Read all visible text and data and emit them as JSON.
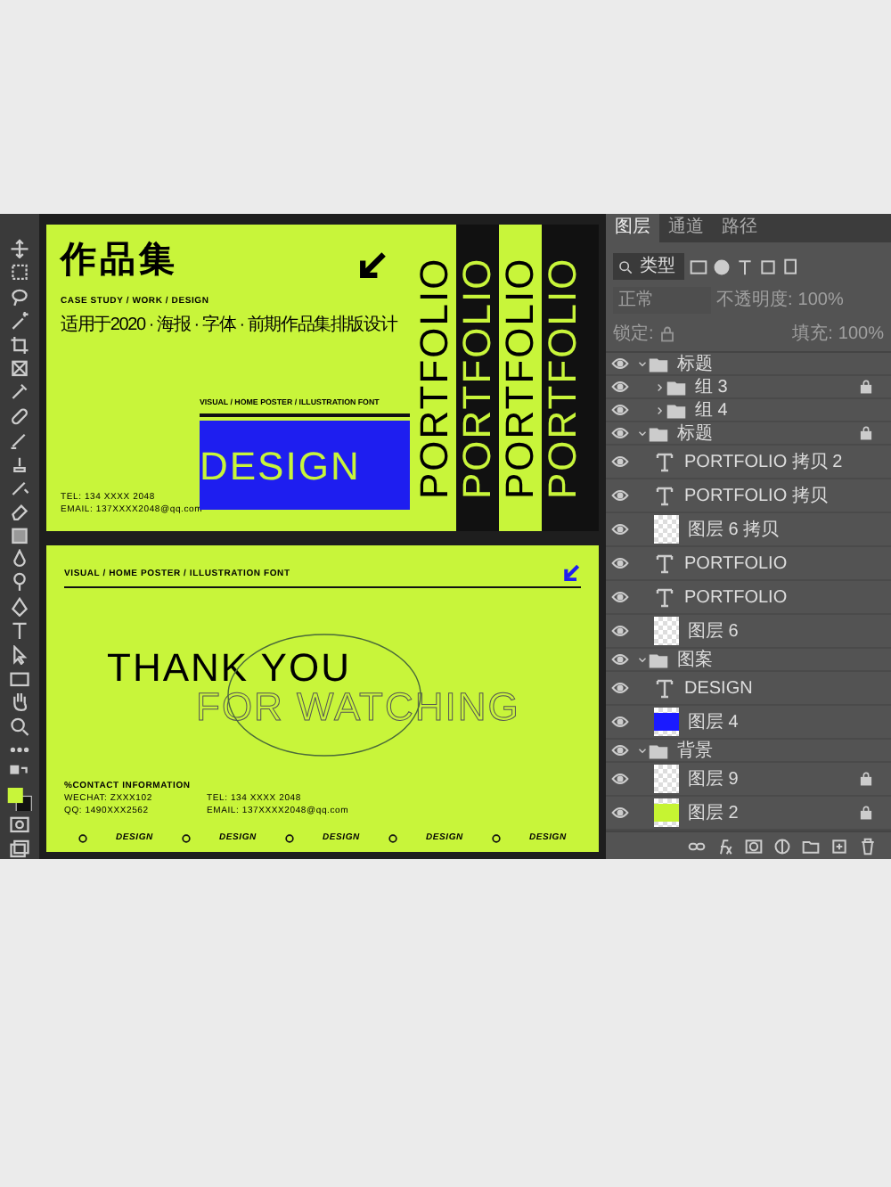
{
  "artboard_top": {
    "title": "作品集",
    "subtitle": "CASE STUDY / WORK / DESIGN",
    "description": "适用于2020 · 海报 · 字体 · 前期作品集排版设计",
    "tagline": "VISUAL / HOME POSTER / ILLUSTRATION FONT",
    "design": "DESIGN",
    "contacts": [
      "TEL: 134 XXXX 2048",
      "EMAIL: 137XXXX2048@qq.com"
    ],
    "portfolio": [
      {
        "text": "PORTFOLIO",
        "inverted": false
      },
      {
        "text": "PORTFOLIO",
        "inverted": true
      },
      {
        "text": "PORTFOLIO",
        "inverted": false
      },
      {
        "text": "PORTFOLIO",
        "inverted": true
      }
    ]
  },
  "artboard_bottom": {
    "tagline": "VISUAL / HOME POSTER / ILLUSTRATION FONT",
    "headline": "THANK YOU",
    "subheadline": "FOR WATCHING",
    "contact_heading": "%CONTACT INFORMATION",
    "contacts": [
      "WECHAT: ZXXX102",
      "TEL: 134 XXXX 2048",
      "QQ: 1490XXX2562",
      "EMAIL: 137XXXX2048@qq.com"
    ],
    "marquee": [
      "DESIGN",
      "DESIGN",
      "DESIGN",
      "DESIGN",
      "DESIGN"
    ]
  },
  "layers_panel": {
    "tabs": [
      {
        "label": "图层",
        "selected": true
      },
      {
        "label": "通道",
        "selected": false
      },
      {
        "label": "路径",
        "selected": false
      }
    ],
    "filter": "类型",
    "blend_mode": "正常",
    "opacity_label": "不透明度:",
    "opacity": "100%",
    "lock_label": "锁定:",
    "fill_label": "填充:",
    "fill": "100%",
    "layers": [
      {
        "name": "标题",
        "kind": "group",
        "expanded": true,
        "locked": false,
        "children": [
          {
            "name": "组 3",
            "kind": "group",
            "expanded": false,
            "locked": true
          },
          {
            "name": "组 4",
            "kind": "group",
            "expanded": false,
            "locked": false
          }
        ]
      },
      {
        "name": "标题",
        "kind": "group",
        "expanded": true,
        "locked": true,
        "children": [
          {
            "name": "PORTFOLIO 拷贝 2",
            "kind": "text",
            "locked": false
          },
          {
            "name": "PORTFOLIO 拷贝",
            "kind": "text",
            "locked": false
          },
          {
            "name": "图层 6 拷贝",
            "kind": "pixel",
            "locked": false
          },
          {
            "name": "PORTFOLIO",
            "kind": "text",
            "locked": false
          },
          {
            "name": "PORTFOLIO",
            "kind": "text",
            "locked": false
          },
          {
            "name": "图层 6",
            "kind": "pixel",
            "locked": false
          }
        ]
      },
      {
        "name": "图案",
        "kind": "group",
        "expanded": true,
        "locked": false,
        "children": [
          {
            "name": "DESIGN",
            "kind": "text",
            "locked": false
          },
          {
            "name": "图层 4",
            "kind": "pixel",
            "locked": false,
            "color": "#1a1aff"
          }
        ]
      },
      {
        "name": "背景",
        "kind": "group",
        "expanded": true,
        "locked": false,
        "children": [
          {
            "name": "图层 9",
            "kind": "pixel",
            "locked": true
          },
          {
            "name": "图层 2",
            "kind": "pixel",
            "locked": true,
            "color": "#c6f432"
          }
        ]
      }
    ]
  }
}
